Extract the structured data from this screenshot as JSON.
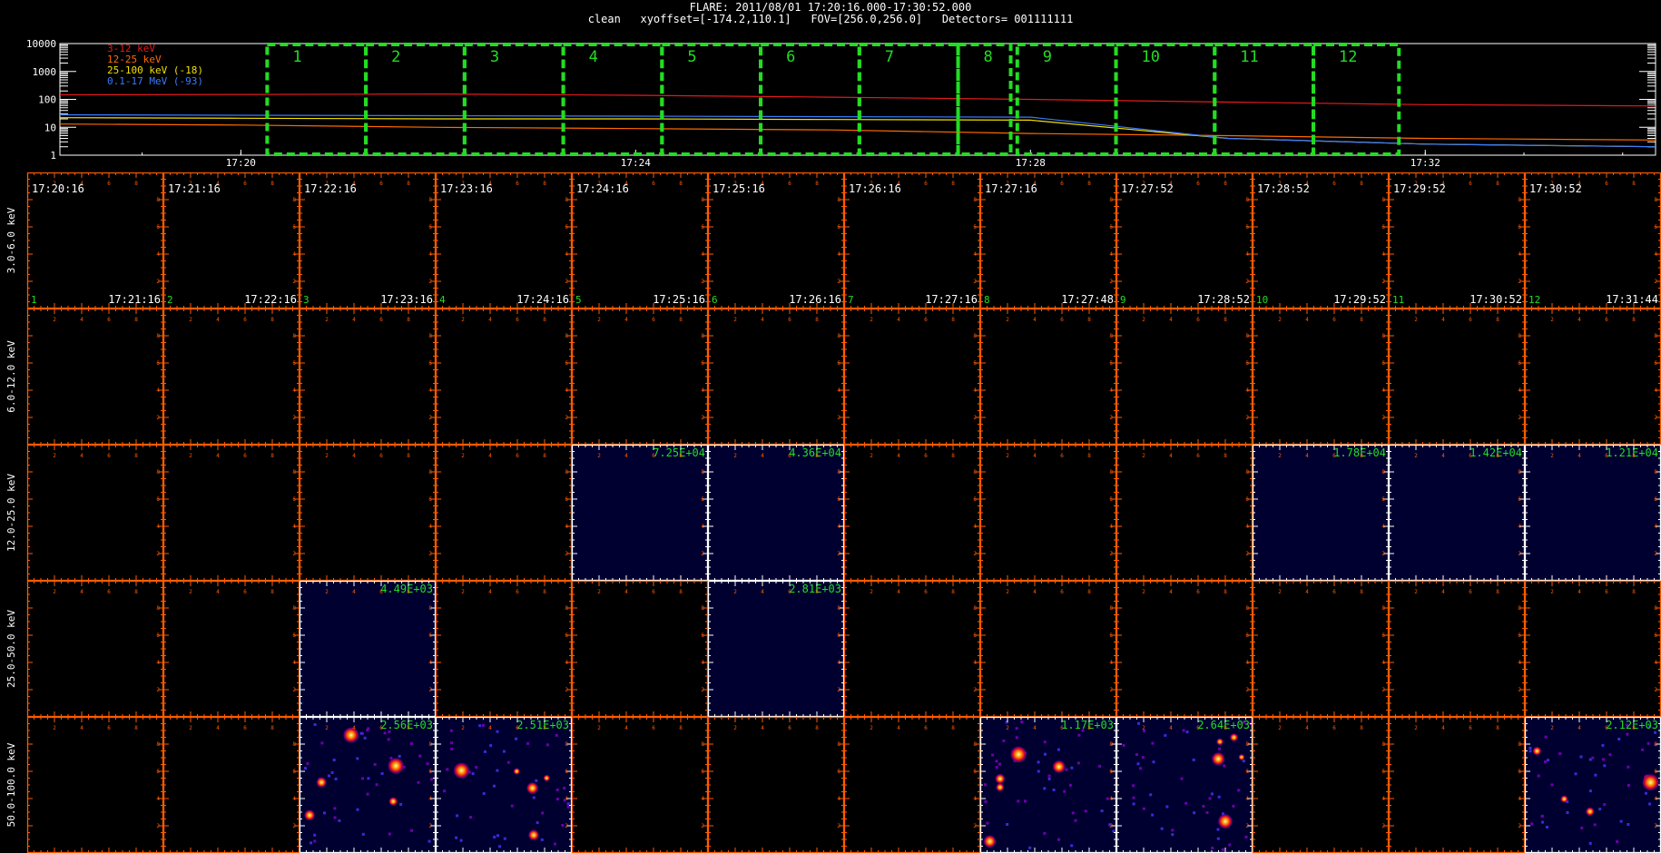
{
  "header": {
    "line1": "FLARE: 2011/08/01 17:20:16.000-17:30:52.000",
    "line2": "clean   xyoffset=[-174.2,110.1]   FOV=[256.0,256.0]   Detectors= 001111111"
  },
  "lightcurve": {
    "yticks": [
      "10000",
      "1000",
      "100",
      "10",
      "1"
    ],
    "xticks": [
      "17:20",
      "17:24",
      "17:28",
      "17:32"
    ],
    "legend": [
      {
        "label": "3-12 keV",
        "color": "#e41a1c"
      },
      {
        "label": "12-25 keV",
        "color": "#ff6a00"
      },
      {
        "label": "25-100 keV (-18)",
        "color": "#f2e000"
      },
      {
        "label": "0.1-17 MeV (-93)",
        "color": "#3a7bff"
      }
    ],
    "interval_labels": [
      "1",
      "2",
      "3",
      "4",
      "5",
      "6",
      "7",
      "8",
      "9",
      "10",
      "11",
      "12"
    ],
    "box_color": "#22dd22"
  },
  "chart_data": {
    "type": "line",
    "x_unit": "time",
    "xlim": [
      "17:18:10",
      "17:34:20"
    ],
    "ylim": [
      1,
      10000
    ],
    "y_scale": "log",
    "series": [
      {
        "name": "3-12 keV",
        "color": "#e41a1c",
        "x": [
          "17:18:10",
          "17:20",
          "17:22",
          "17:24",
          "17:26",
          "17:28",
          "17:30",
          "17:32",
          "17:34:20"
        ],
        "values": [
          145,
          150,
          155,
          140,
          120,
          100,
          80,
          65,
          58
        ]
      },
      {
        "name": "12-25 keV",
        "color": "#ff6a00",
        "x": [
          "17:18:10",
          "17:20",
          "17:22",
          "17:24",
          "17:26",
          "17:28",
          "17:30",
          "17:32",
          "17:34:20"
        ],
        "values": [
          13,
          12,
          10,
          9,
          8,
          6,
          5,
          4,
          3.5
        ]
      },
      {
        "name": "25-100 keV (-18)",
        "color": "#f2e000",
        "x": [
          "17:18:10",
          "17:20",
          "17:22",
          "17:24",
          "17:26",
          "17:28",
          "17:30",
          "17:32",
          "17:34:20"
        ],
        "values": [
          22,
          21,
          20,
          20,
          19,
          18,
          4,
          2.5,
          2
        ]
      },
      {
        "name": "0.1-17 MeV (-93)",
        "color": "#3a7bff",
        "x": [
          "17:18:10",
          "17:20",
          "17:22",
          "17:24",
          "17:26",
          "17:28",
          "17:30",
          "17:32",
          "17:34:20"
        ],
        "values": [
          28,
          27,
          26,
          25,
          24,
          23,
          4,
          2.5,
          2
        ]
      }
    ],
    "intervals": [
      [
        "17:20:16",
        "17:21:16"
      ],
      [
        "17:21:16",
        "17:22:16"
      ],
      [
        "17:22:16",
        "17:23:16"
      ],
      [
        "17:23:16",
        "17:24:16"
      ],
      [
        "17:24:16",
        "17:25:16"
      ],
      [
        "17:25:16",
        "17:26:16"
      ],
      [
        "17:26:16",
        "17:27:16"
      ],
      [
        "17:27:16",
        "17:27:48"
      ],
      [
        "17:27:52",
        "17:28:52"
      ],
      [
        "17:28:52",
        "17:29:52"
      ],
      [
        "17:29:52",
        "17:30:52"
      ],
      [
        "17:30:52",
        "17:31:44"
      ]
    ]
  },
  "image_grid": {
    "energy_bands": [
      "3.0-6.0 keV",
      "6.0-12.0 keV",
      "12.0-25.0 keV",
      "25.0-50.0 keV",
      "50.0-100.0 keV"
    ],
    "start_times": [
      "17:20:16",
      "17:21:16",
      "17:22:16",
      "17:23:16",
      "17:24:16",
      "17:25:16",
      "17:26:16",
      "17:27:16",
      "17:27:52",
      "17:28:52",
      "17:29:52",
      "17:30:52"
    ],
    "end_times": [
      "17:21:16",
      "17:22:16",
      "17:23:16",
      "17:24:16",
      "17:25:16",
      "17:26:16",
      "17:27:16",
      "17:27:48",
      "17:28:52",
      "17:29:52",
      "17:30:52",
      "17:31:44"
    ],
    "interval_numbers": [
      "1",
      "2",
      "3",
      "4",
      "5",
      "6",
      "7",
      "8",
      "9",
      "10",
      "11",
      "12"
    ],
    "panel_tick_labels": [
      "2",
      "4",
      "6",
      "8"
    ],
    "axis_color": "#ff5a00",
    "image_cells": [
      {
        "row": 2,
        "col": 4,
        "max": "7.25E+04",
        "style": "flat"
      },
      {
        "row": 2,
        "col": 5,
        "max": "4.36E+04",
        "style": "flat"
      },
      {
        "row": 2,
        "col": 9,
        "max": "1.78E+04",
        "style": "flat"
      },
      {
        "row": 2,
        "col": 10,
        "max": "1.42E+04",
        "style": "flat"
      },
      {
        "row": 2,
        "col": 11,
        "max": "1.21E+04",
        "style": "flat"
      },
      {
        "row": 3,
        "col": 2,
        "max": "4.49E+03",
        "style": "flat"
      },
      {
        "row": 3,
        "col": 5,
        "max": "2.81E+03",
        "style": "flat"
      },
      {
        "row": 4,
        "col": 2,
        "max": "2.56E+03",
        "style": "noise"
      },
      {
        "row": 4,
        "col": 3,
        "max": "2.51E+03",
        "style": "noise"
      },
      {
        "row": 4,
        "col": 7,
        "max": "1.17E+03",
        "style": "noise"
      },
      {
        "row": 4,
        "col": 8,
        "max": "2.64E+03",
        "style": "noise"
      },
      {
        "row": 4,
        "col": 11,
        "max": "2.12E+03",
        "style": "noise"
      }
    ]
  }
}
